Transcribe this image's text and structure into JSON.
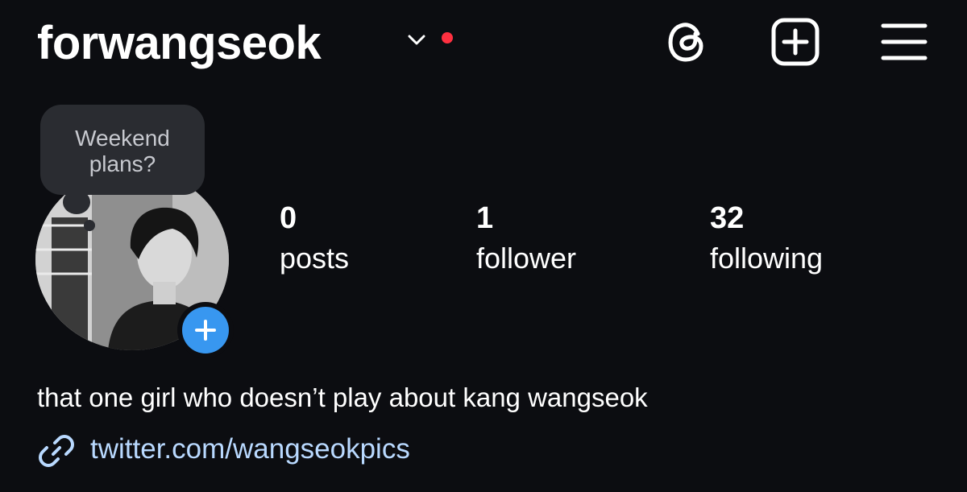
{
  "header": {
    "username": "forwangseok",
    "icons": [
      "chevron-down-icon",
      "threads-icon",
      "new-post-icon",
      "menu-icon"
    ],
    "notification_color": "#ff3040"
  },
  "note": {
    "text": "Weekend\nplans?"
  },
  "stats": [
    {
      "value": "0",
      "label": "posts"
    },
    {
      "value": "1",
      "label": "follower"
    },
    {
      "value": "32",
      "label": "following"
    }
  ],
  "bio": {
    "text": "that one girl who doesn’t play about kang wangseok"
  },
  "link": {
    "text": "twitter.com/wangseokpics"
  },
  "colors": {
    "background": "#0c0d11",
    "accent": "#3897f0",
    "link": "#b9d9ff"
  }
}
